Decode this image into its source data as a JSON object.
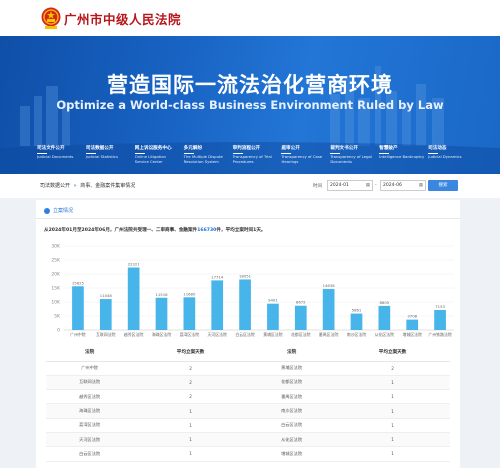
{
  "header": {
    "court_name": "广州市中级人民法院"
  },
  "banner": {
    "title_cn": "营造国际一流法治化营商环境",
    "title_en": "Optimize a World-class Business Environment Ruled by Law"
  },
  "nav": {
    "items": [
      {
        "cn": "司法文件公开",
        "en": "Judicial Documents"
      },
      {
        "cn": "司法数据公开",
        "en": "Judicial Statistics"
      },
      {
        "cn": "网上诉讼服务中心",
        "en": "Online Litigation Service Center"
      },
      {
        "cn": "多元解纷",
        "en": "The Multiple Dispute Resolution System"
      },
      {
        "cn": "审判流程公开",
        "en": "Transparency of Trial Procedures"
      },
      {
        "cn": "庭审公开",
        "en": "Transparency of Case Hearings"
      },
      {
        "cn": "裁判文书公开",
        "en": "Transparency of Legal Documents"
      },
      {
        "cn": "智慧破产",
        "en": "Intelligence Bankruptcy"
      },
      {
        "cn": "司法动态",
        "en": "Judicial Dynamics"
      }
    ]
  },
  "filter": {
    "breadcrumb_root": "司法数据公开",
    "breadcrumb_sep": "»",
    "breadcrumb_current": "商事、金融案件集审情况",
    "date_label": "时间",
    "start_date": "2024-01",
    "date_sep": "-",
    "end_date": "2024-06",
    "search_label": "搜索"
  },
  "section": {
    "title": "立案情况",
    "summary_prefix": "从2024年01月至2024年06月，广州法院共受理一、二审商事、金融案件",
    "summary_number": "166730",
    "summary_suffix": "件，平均立案时间1天。"
  },
  "chart_data": {
    "type": "bar",
    "categories": [
      "广州中院",
      "互联网法院",
      "越秀区法院",
      "海珠区法院",
      "荔湾区法院",
      "天河区法院",
      "白云区法院",
      "黄埔区法院",
      "花都区法院",
      "番禺区法院",
      "南沙区法院",
      "从化区法院",
      "增城区法院",
      "广州铁路法院"
    ],
    "values": [
      15625,
      11048,
      22321,
      11516,
      11680,
      17714,
      18051,
      9401,
      8672,
      14636,
      5861,
      8605,
      3708,
      7153
    ],
    "ylim": [
      0,
      30000
    ],
    "yticks": [
      "0",
      "5K",
      "10K",
      "15K",
      "20K",
      "25K",
      "30K"
    ],
    "bar_color": "#47b5ea",
    "grid": true
  },
  "table": {
    "headers": [
      "法院",
      "平均立案天数",
      "法院",
      "平均立案天数"
    ],
    "rows": [
      [
        "广州中院",
        "2",
        "黄埔区法院",
        "2"
      ],
      [
        "互联网法院",
        "2",
        "花都区法院",
        "1"
      ],
      [
        "越秀区法院",
        "2",
        "番禺区法院",
        "1"
      ],
      [
        "海珠区法院",
        "1",
        "南沙区法院",
        "1"
      ],
      [
        "荔湾区法院",
        "1",
        "白云区法院",
        "1"
      ],
      [
        "天河区法院",
        "1",
        "从化区法院",
        "1"
      ],
      [
        "白云区法院",
        "1",
        "增城区法院",
        "1"
      ]
    ]
  },
  "colors": {
    "accent": "#1e6fd0",
    "brand_red": "#b8141a",
    "bar": "#47b5ea"
  }
}
